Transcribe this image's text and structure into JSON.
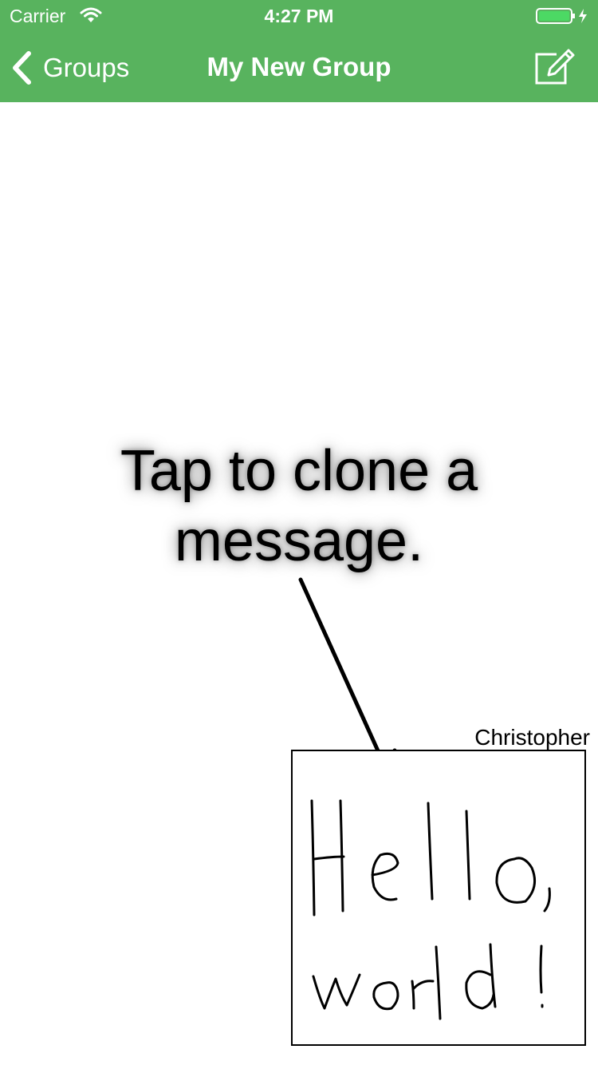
{
  "status_bar": {
    "carrier": "Carrier",
    "time": "4:27 PM",
    "battery_color": "#4cd964"
  },
  "nav": {
    "back_label": "Groups",
    "title": "My New Group",
    "compose_icon": "compose-icon",
    "background_color": "#58b35e"
  },
  "hint": {
    "line1": "Tap to clone a",
    "line2": "message."
  },
  "message": {
    "author": "Christopher",
    "handwritten_text": "Hello, world!"
  }
}
